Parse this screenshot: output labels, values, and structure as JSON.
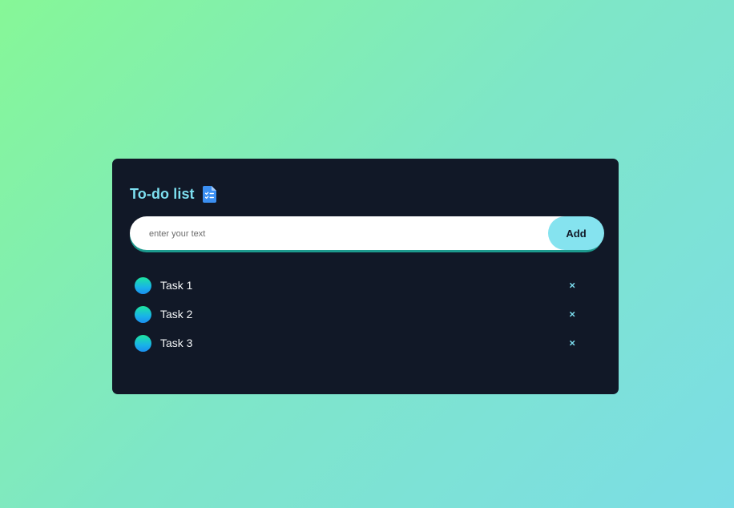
{
  "app": {
    "title": "To-do list",
    "title_icon": "clipboard-checklist-icon"
  },
  "input": {
    "placeholder": "enter your text",
    "value": ""
  },
  "add_button": {
    "label": "Add"
  },
  "tasks": [
    {
      "label": "Task 1",
      "delete_icon": "close-icon",
      "delete_glyph": "×"
    },
    {
      "label": "Task 2",
      "delete_icon": "close-icon",
      "delete_glyph": "×"
    },
    {
      "label": "Task 3",
      "delete_icon": "close-icon",
      "delete_glyph": "×"
    }
  ],
  "colors": {
    "accent": "#7ddff0",
    "card_bg": "#111827",
    "button_bg": "#85e3ef"
  }
}
